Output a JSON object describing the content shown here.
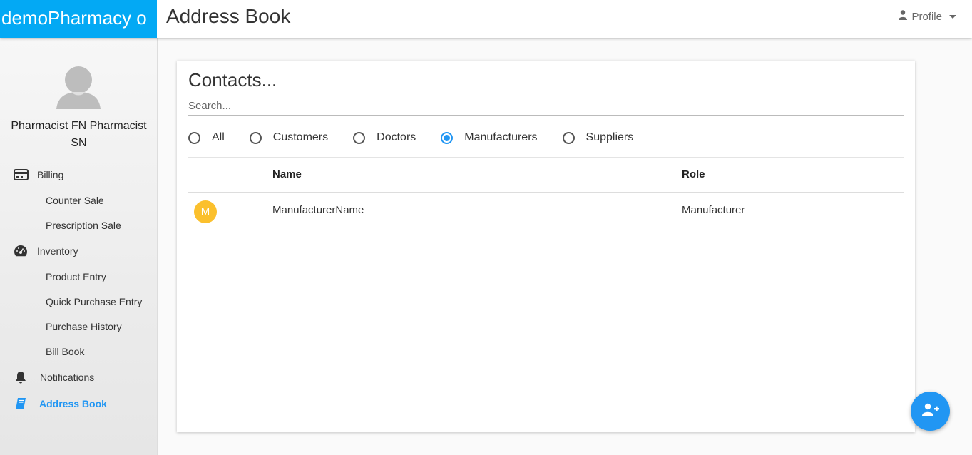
{
  "app": {
    "brand": "demoPharmacy o",
    "page_title": "Address Book"
  },
  "header": {
    "profile_label": "Profile"
  },
  "sidebar": {
    "user_name": "Pharmacist FN Pharmacist SN",
    "sections": {
      "billing": {
        "label": "Billing",
        "items": [
          "Counter Sale",
          "Prescription Sale"
        ]
      },
      "inventory": {
        "label": "Inventory",
        "items": [
          "Product Entry",
          "Quick Purchase Entry",
          "Purchase History",
          "Bill Book"
        ]
      },
      "notifications": {
        "label": "Notifications"
      },
      "address_book": {
        "label": "Address Book"
      }
    },
    "active_color": "#2196f3"
  },
  "contacts": {
    "title": "Contacts...",
    "search_placeholder": "Search...",
    "filters": [
      "All",
      "Customers",
      "Doctors",
      "Manufacturers",
      "Suppliers"
    ],
    "selected_filter": "Manufacturers",
    "columns": {
      "name": "Name",
      "role": "Role"
    },
    "rows": [
      {
        "initial": "M",
        "name": "ManufacturerName",
        "role": "Manufacturer",
        "avatar_color": "#fbc02d"
      }
    ]
  },
  "colors": {
    "brand_bg": "#03a9f4",
    "accent": "#2196f3"
  },
  "fab": {
    "icon": "user-plus-icon"
  }
}
